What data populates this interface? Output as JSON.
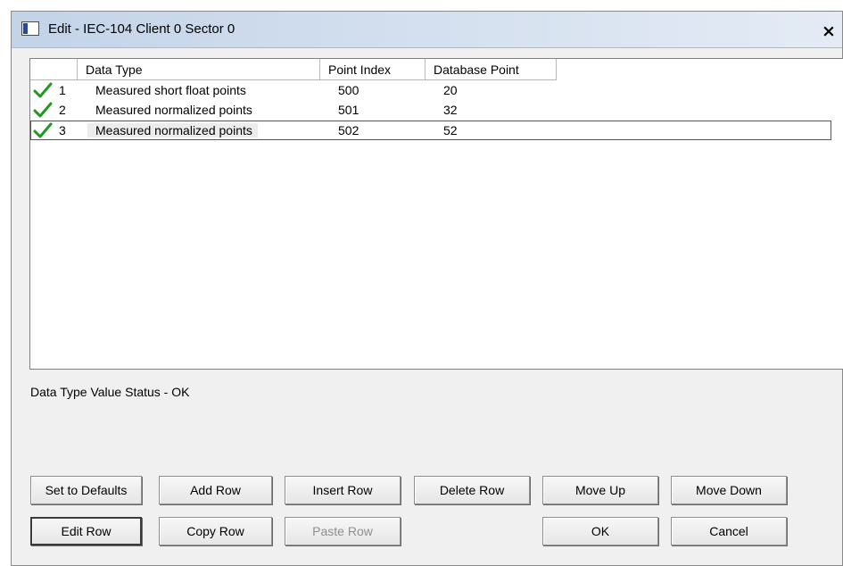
{
  "window": {
    "title": "Edit - IEC-104 Client 0 Sector 0",
    "close_label": "×"
  },
  "grid": {
    "columns": [
      "Data Type",
      "Point Index",
      "Database Point"
    ],
    "rows": [
      {
        "num": "1",
        "status_icon": "check-icon",
        "data_type": "Measured short float points",
        "point_index": "500",
        "database_point": "20"
      },
      {
        "num": "2",
        "status_icon": "check-icon",
        "data_type": "Measured normalized points",
        "point_index": "501",
        "database_point": "32"
      },
      {
        "num": "3",
        "status_icon": "check-icon",
        "data_type": "Measured normalized points",
        "point_index": "502",
        "database_point": "52",
        "selected": true
      }
    ]
  },
  "status_text": "Data Type Value Status - OK",
  "buttons": {
    "set_defaults": "Set to Defaults",
    "add_row": "Add Row",
    "insert_row": "Insert Row",
    "delete_row": "Delete Row",
    "move_up": "Move Up",
    "move_down": "Move Down",
    "edit_row": "Edit Row",
    "copy_row": "Copy Row",
    "paste_row": "Paste Row",
    "ok": "OK",
    "cancel": "Cancel"
  },
  "colors": {
    "check": "#1f9a1f",
    "titlebar": "#c3d3e8"
  }
}
